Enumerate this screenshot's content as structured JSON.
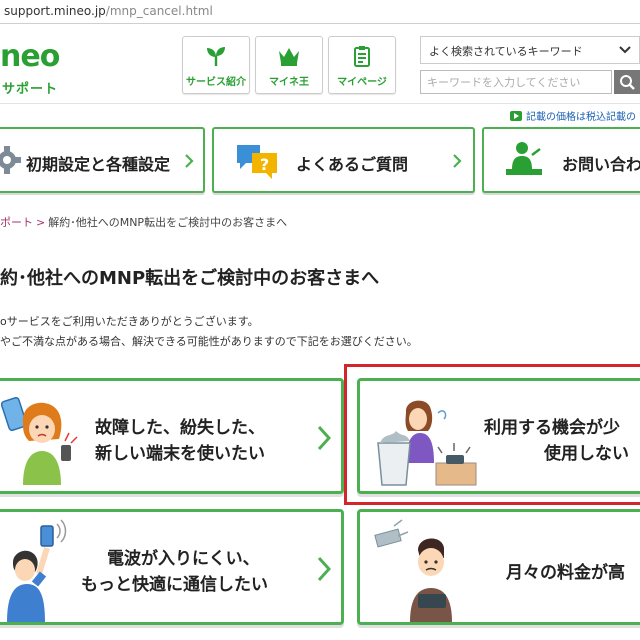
{
  "browser": {
    "url_host": "support.mineo.jp",
    "url_path": "/mnp_cancel.html"
  },
  "header": {
    "logo": "neo",
    "logo_sub": "サポート",
    "nav": [
      {
        "label": "サービス紹介",
        "icon": "sprout-icon"
      },
      {
        "label": "マイネ王",
        "icon": "crown-icon"
      },
      {
        "label": "マイページ",
        "icon": "clipboard-icon"
      }
    ],
    "keyword_select": "よく検索されているキーワード",
    "keyword_placeholder": "キーワードを入力してください"
  },
  "tax_note": "記載の価格は税込記載の",
  "main_nav": [
    {
      "label": "初期設定と各種設定",
      "icon": "gear-icon"
    },
    {
      "label": "よくあるご質問",
      "icon": "question-bubble-icon"
    },
    {
      "label": "お問い合わ",
      "icon": "support-person-icon"
    }
  ],
  "breadcrumb": {
    "top": "ポート",
    "separator": ">",
    "current": "解約･他社へのMNP転出をご検討中のお客さまへ"
  },
  "page": {
    "title": "約･他社へのMNP転出をご検討中のお客さまへ",
    "intro_line1": "oサービスをご利用いただきありがとうございます。",
    "intro_line2": "やご不満な点がある場合、解決できる可能性がありますので下記をお選びください。"
  },
  "choices": [
    {
      "line1": "故障した、紛失した、",
      "line2": "新しい端末を使いたい"
    },
    {
      "line1": "利用する機会が少",
      "line2": "使用しない"
    },
    {
      "line1": "電波が入りにくい、",
      "line2": "もっと快適に通信したい"
    },
    {
      "line1": "月々の料金が高",
      "line2": ""
    }
  ],
  "colors": {
    "brand_green": "#2aa034",
    "card_border": "#4cb050",
    "highlight_red": "#d3252c",
    "link_blue": "#1a5fb4",
    "crumb_pink": "#a8326b"
  }
}
